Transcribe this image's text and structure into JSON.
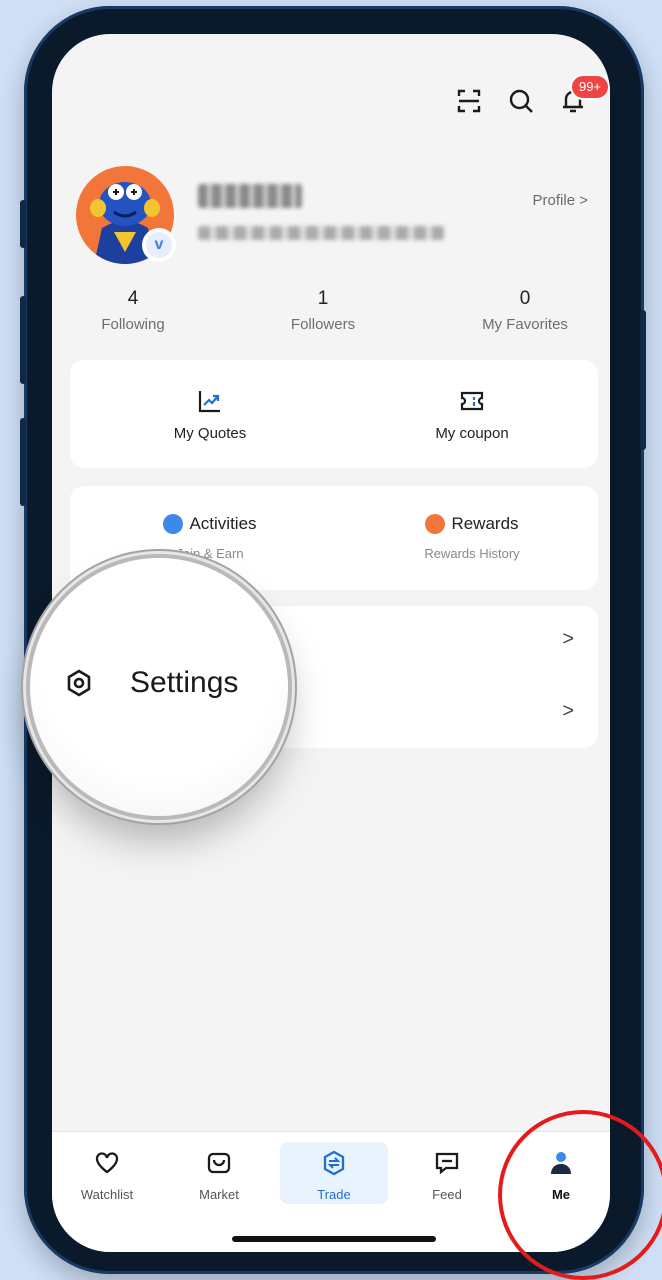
{
  "header": {
    "notification_badge": "99+"
  },
  "profile": {
    "verify_letter": "v",
    "link_label": "Profile >"
  },
  "stats": [
    {
      "value": "4",
      "label": "Following"
    },
    {
      "value": "1",
      "label": "Followers"
    },
    {
      "value": "0",
      "label": "My Favorites"
    }
  ],
  "tools": [
    {
      "label": "My Quotes",
      "icon": "chart-up-icon"
    },
    {
      "label": "My coupon",
      "icon": "coupon-icon"
    }
  ],
  "activities": [
    {
      "title": "Activities",
      "subtitle": "Join & Earn",
      "icon_color": "#3b8ae8"
    },
    {
      "title": "Rewards",
      "subtitle": "Rewards History",
      "icon_color": "#f2763a"
    }
  ],
  "list": {
    "chevron": ">"
  },
  "magnifier": {
    "label": "Settings"
  },
  "nav": [
    {
      "label": "Watchlist",
      "icon": "heart-icon"
    },
    {
      "label": "Market",
      "icon": "bag-icon"
    },
    {
      "label": "Trade",
      "icon": "trade-icon",
      "active": true
    },
    {
      "label": "Feed",
      "icon": "feed-icon"
    },
    {
      "label": "Me",
      "icon": "person-icon",
      "selected": true
    }
  ],
  "colors": {
    "accent": "#1f6fd1",
    "highlight_circle": "#e41b1b"
  }
}
